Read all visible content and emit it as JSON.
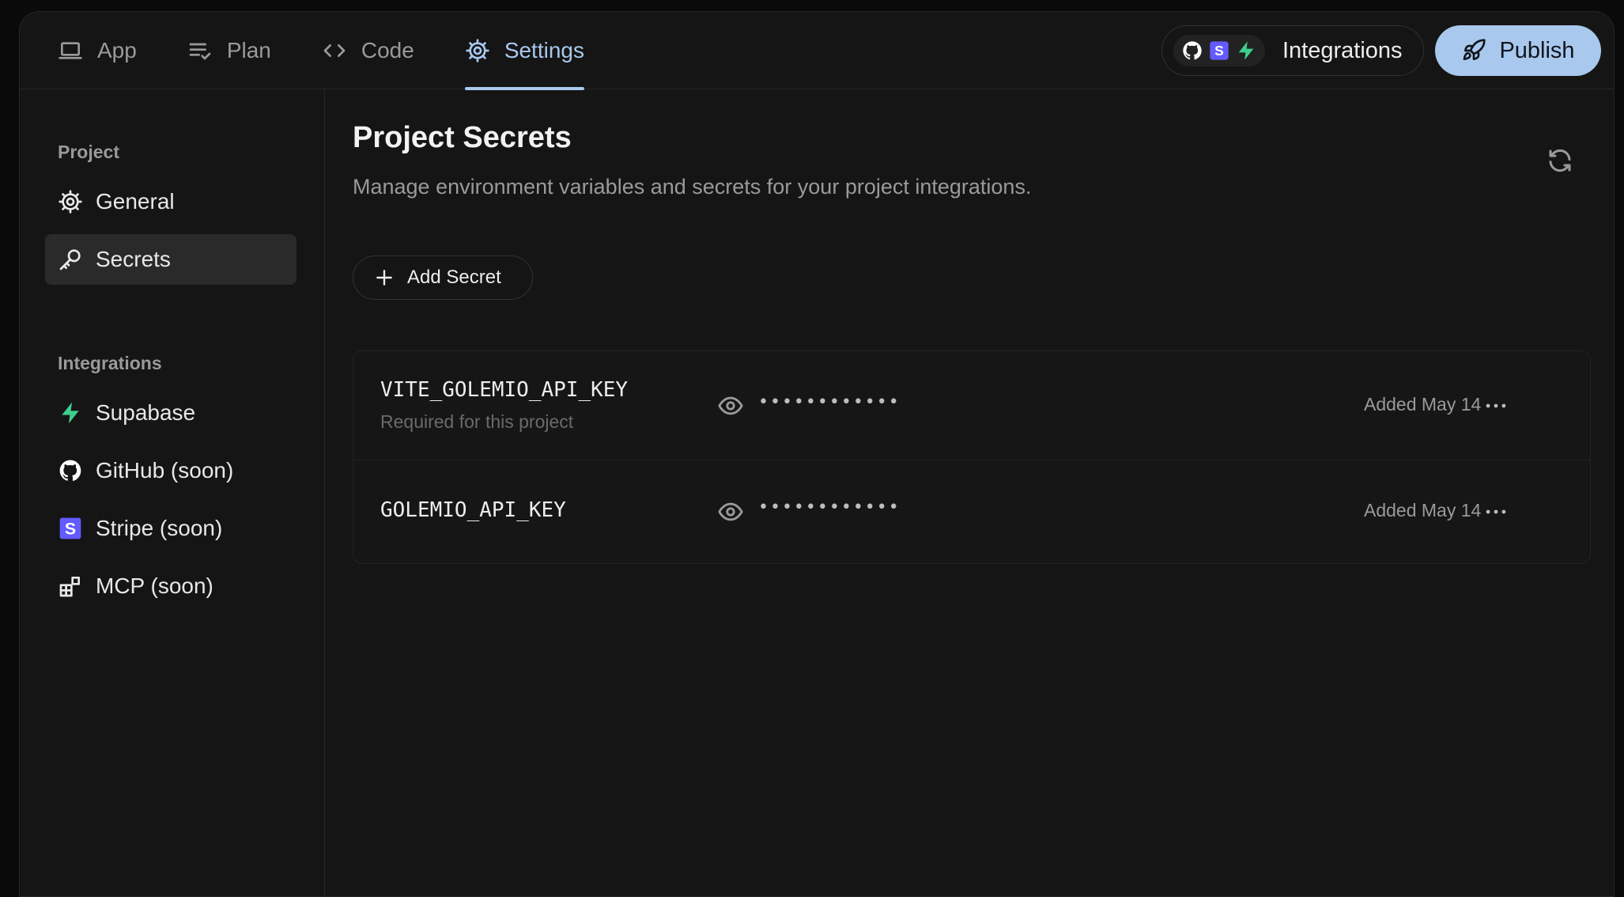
{
  "topbar": {
    "tabs": [
      {
        "label": "App",
        "icon": "laptop-icon"
      },
      {
        "label": "Plan",
        "icon": "checklist-icon"
      },
      {
        "label": "Code",
        "icon": "code-icon"
      },
      {
        "label": "Settings",
        "icon": "gear-icon",
        "active": true
      }
    ],
    "integrations_label": "Integrations",
    "integration_icons": [
      "github-icon",
      "stripe-icon",
      "supabase-icon"
    ],
    "publish_label": "Publish"
  },
  "sidebar": {
    "project_label": "Project",
    "project_items": [
      {
        "label": "General",
        "icon": "gear-icon"
      },
      {
        "label": "Secrets",
        "icon": "key-icon",
        "active": true
      }
    ],
    "integrations_label": "Integrations",
    "integration_items": [
      {
        "label": "Supabase",
        "icon": "supabase-icon"
      },
      {
        "label": "GitHub (soon)",
        "icon": "github-icon"
      },
      {
        "label": "Stripe (soon)",
        "icon": "stripe-icon"
      },
      {
        "label": "MCP (soon)",
        "icon": "blocks-icon"
      }
    ]
  },
  "main": {
    "title": "Project Secrets",
    "description": "Manage environment variables and secrets for your project integrations.",
    "add_button": "Add Secret",
    "secrets": [
      {
        "name": "VITE_GOLEMIO_API_KEY",
        "note": "Required for this project",
        "masked": "••••••••••••",
        "added": "Added May 14"
      },
      {
        "name": "GOLEMIO_API_KEY",
        "note": "",
        "masked": "••••••••••••",
        "added": "Added May 14"
      }
    ]
  },
  "colors": {
    "accent": "#a9c8ee",
    "background": "#151515",
    "supabase_green": "#3ecf8e",
    "stripe_purple": "#635bff"
  }
}
